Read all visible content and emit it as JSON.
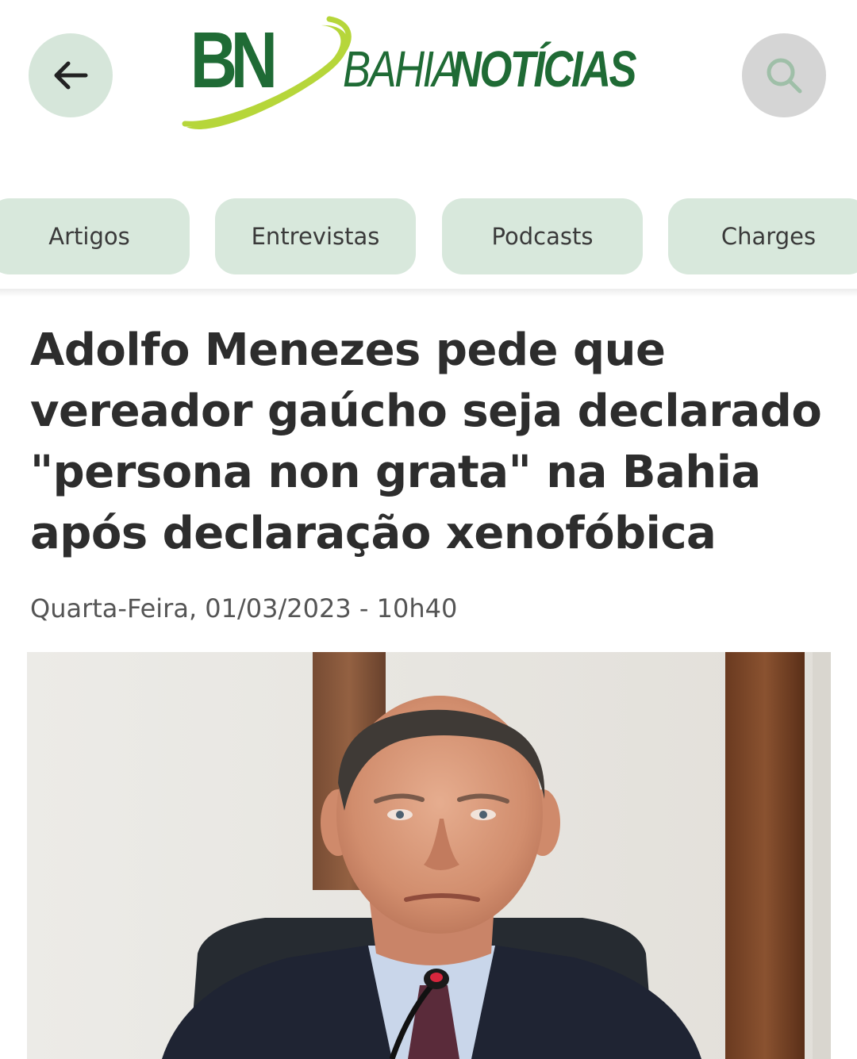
{
  "header": {
    "back_icon": "arrow-left-icon",
    "search_icon": "search-icon",
    "logo": {
      "monogram": "BN",
      "word_light": "BAHIA",
      "word_bold": "NOTÍCIAS"
    },
    "colors": {
      "brand_green": "#1f6b35",
      "accent_lime": "#b6d63a",
      "chip_bg": "#d8e8dc"
    }
  },
  "tabs": [
    {
      "label": "Artigos"
    },
    {
      "label": "Entrevistas"
    },
    {
      "label": "Podcasts"
    },
    {
      "label": "Charges"
    }
  ],
  "article": {
    "title": "Adolfo Menezes pede que vereador gaúcho seja declarado \"persona non grata\" na Bahia após declaração xenofóbica",
    "date": "Quarta-Feira, 01/03/2023 - 10h40"
  }
}
